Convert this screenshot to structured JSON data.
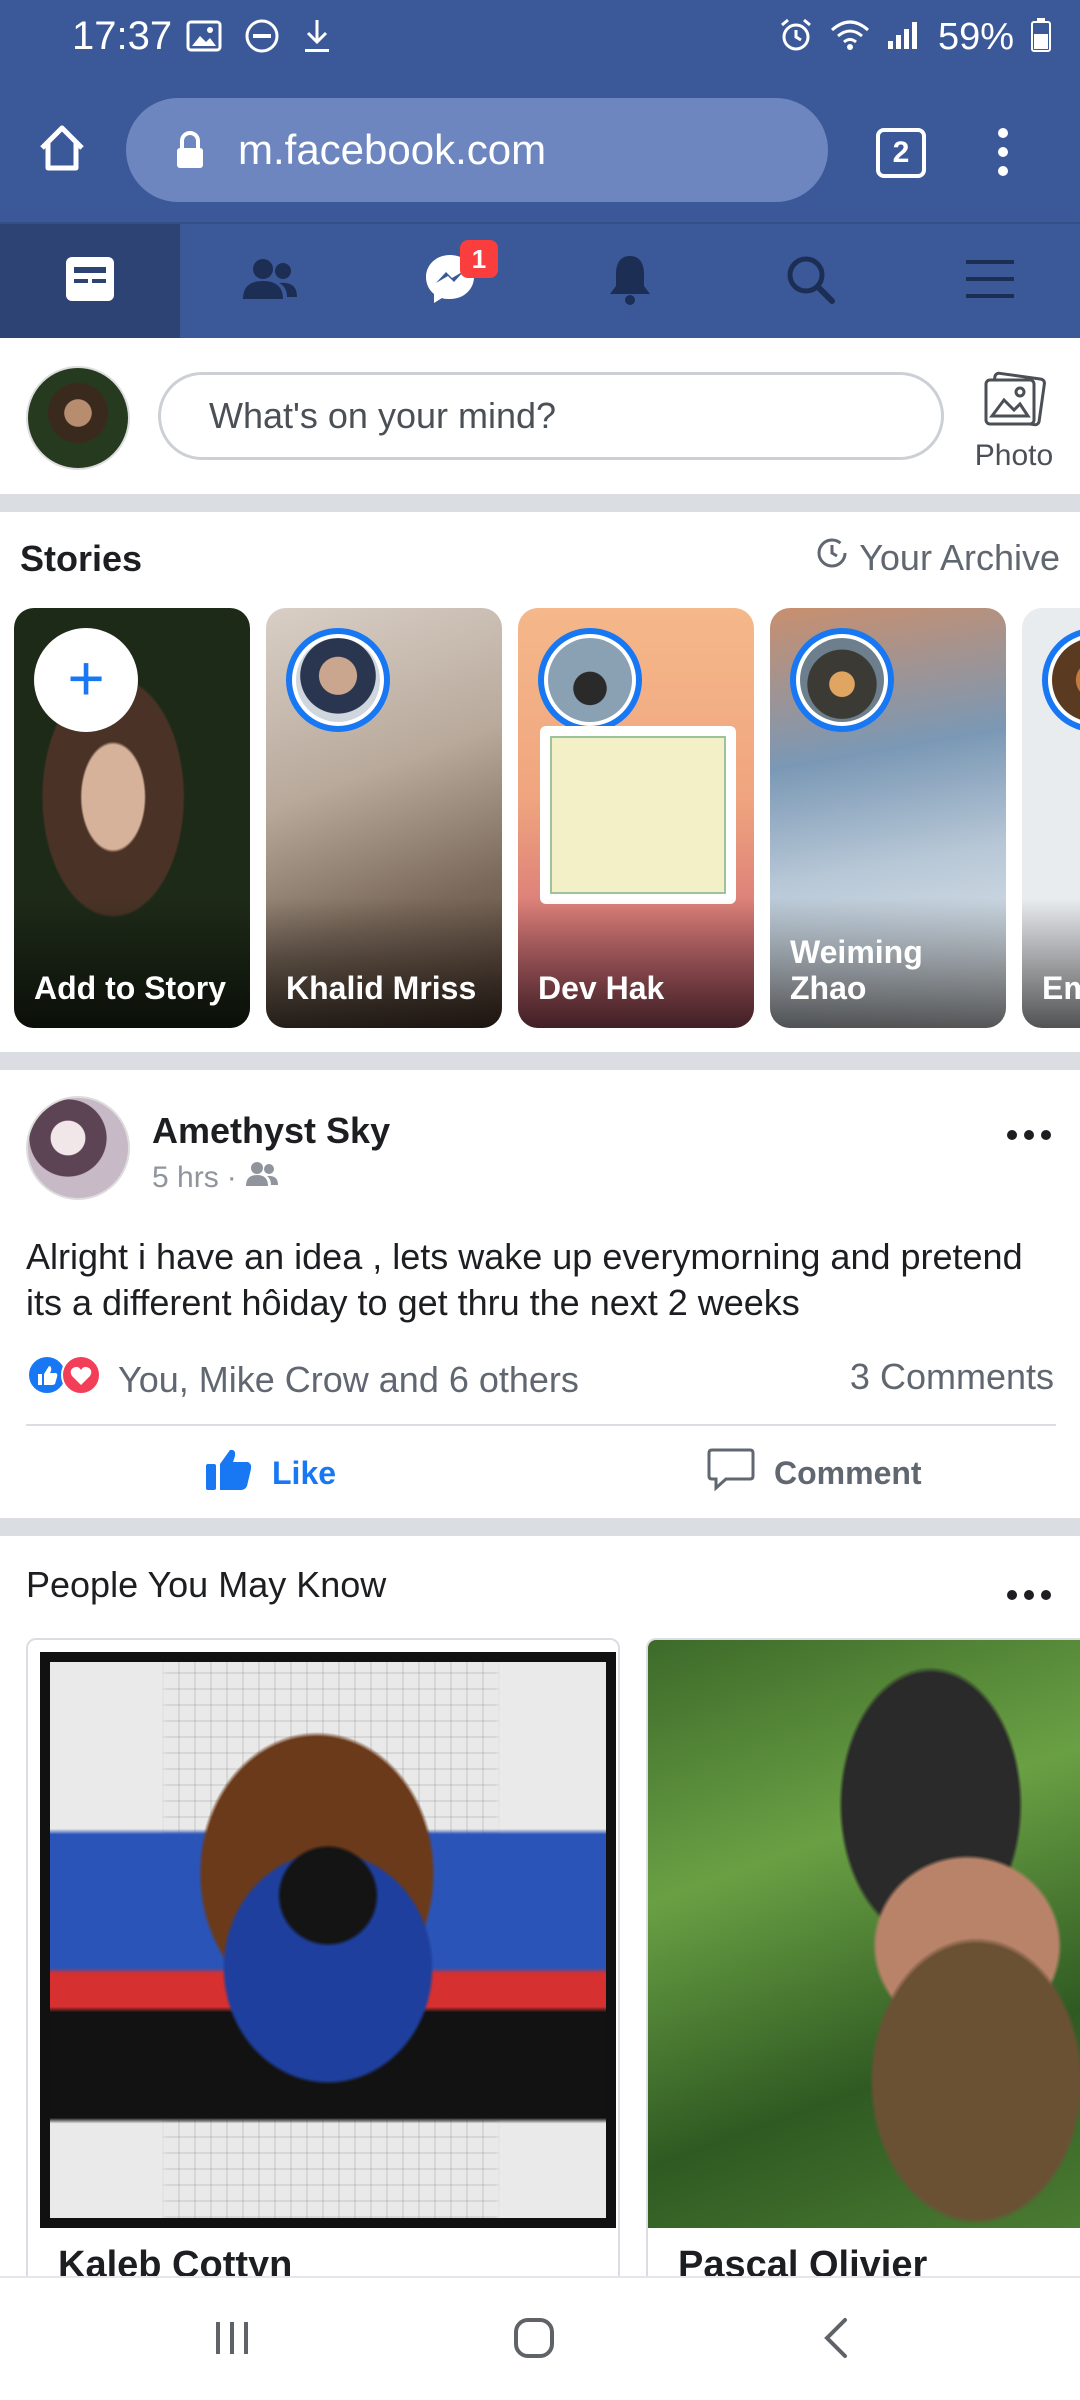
{
  "status_bar": {
    "time": "17:37",
    "battery": "59%"
  },
  "browser": {
    "url": "m.facebook.com",
    "tab_count": "2"
  },
  "fb_nav": {
    "items": [
      {
        "name": "news-feed",
        "icon": "news-feed-icon",
        "active": true
      },
      {
        "name": "friends",
        "icon": "friends-icon"
      },
      {
        "name": "messenger",
        "icon": "messenger-icon",
        "badge": "1"
      },
      {
        "name": "notifications",
        "icon": "bell-icon"
      },
      {
        "name": "search",
        "icon": "search-icon"
      },
      {
        "name": "menu",
        "icon": "hamburger-icon"
      }
    ],
    "messenger_badge": "1"
  },
  "composer": {
    "placeholder": "What's on your mind?",
    "photo_label": "Photo"
  },
  "stories": {
    "title": "Stories",
    "archive_label": "Your Archive",
    "items": [
      {
        "name": "Add to Story"
      },
      {
        "name": "Khalid Mriss"
      },
      {
        "name": "Dev Hak"
      },
      {
        "name": "Weiming Zhao"
      },
      {
        "name": "Em Co"
      }
    ]
  },
  "post": {
    "author": "Amethyst Sky",
    "time": "5 hrs",
    "text": "Alright i have an idea , lets wake up everymorning and pretend its a different hôiday to get thru the next 2 weeks",
    "reactions_text": "You, Mike Crow and 6 others",
    "comments_text": "3 Comments",
    "like_label": "Like",
    "comment_label": "Comment"
  },
  "pymk": {
    "title": "People You May Know",
    "people": [
      {
        "name": "Kaleb Cottyn"
      },
      {
        "name": "Pascal Olivier"
      }
    ]
  },
  "colors": {
    "brand": "#3b5998",
    "accent": "#1877f2",
    "badge": "#fa3e3e"
  }
}
